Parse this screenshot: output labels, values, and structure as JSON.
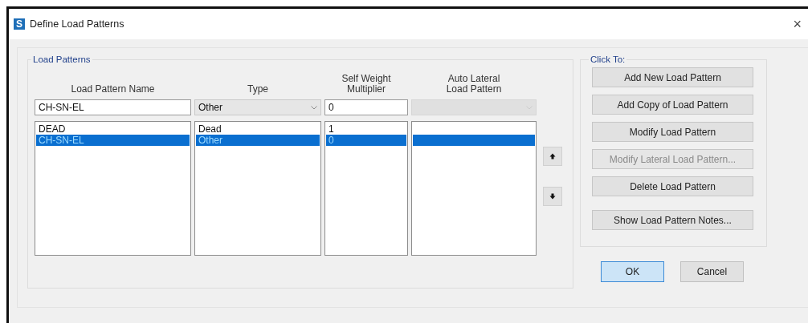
{
  "window": {
    "app_icon": "S",
    "title": "Define Load Patterns",
    "close": "×"
  },
  "load_patterns": {
    "group_title": "Load Patterns",
    "columns": [
      {
        "label": "Load Pattern Name"
      },
      {
        "label": "Type"
      },
      {
        "label": "Self Weight Multiplier"
      },
      {
        "label": "Auto Lateral Load Pattern"
      }
    ],
    "name_field": {
      "value": "CH-SN-EL"
    },
    "type_field": {
      "value": "Other"
    },
    "multiplier_field": {
      "value": "0"
    },
    "auto_lateral_field": {
      "disabled": true
    },
    "rows": [
      {
        "name": "DEAD",
        "type": "Dead",
        "multiplier": "1",
        "selected": false
      },
      {
        "name": "CH-SN-EL",
        "type": "Other",
        "multiplier": "0",
        "selected": true
      }
    ]
  },
  "click_to": {
    "group_title": "Click To:",
    "buttons": [
      {
        "label": "Add New Load Pattern",
        "disabled": false
      },
      {
        "label": "Add Copy of Load Pattern",
        "disabled": false
      },
      {
        "label": "Modify Load Pattern",
        "disabled": false
      },
      {
        "label": "Modify Lateral Load Pattern...",
        "disabled": true
      },
      {
        "label": "Delete Load Pattern",
        "disabled": false
      },
      {
        "label": "Show Load Pattern Notes...",
        "disabled": false
      }
    ]
  },
  "dialog_buttons": [
    {
      "label": "OK",
      "default": true
    },
    {
      "label": "Cancel",
      "default": false
    }
  ]
}
